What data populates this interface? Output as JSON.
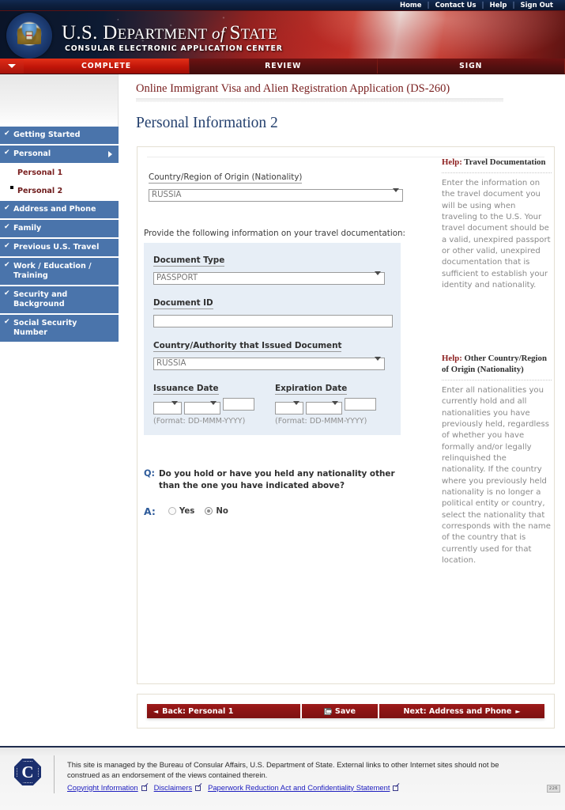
{
  "utility": {
    "links": [
      "Home",
      "Contact Us",
      "Help",
      "Sign Out"
    ],
    "separator": "|"
  },
  "banner": {
    "title_us": "U.S. D",
    "title_epartment": "EPARTMENT",
    "title_of": " of ",
    "title_s": "S",
    "title_tate": "TATE",
    "subtitle": "CONSULAR ELECTRONIC APPLICATION CENTER",
    "seal_name": "us-department-of-state-seal"
  },
  "steps": [
    {
      "label": "COMPLETE",
      "active": true
    },
    {
      "label": "REVIEW",
      "active": false
    },
    {
      "label": "SIGN",
      "active": false
    }
  ],
  "sidebar": {
    "items": [
      {
        "label": "Getting Started",
        "type": "section",
        "check": "✔",
        "expandable": false
      },
      {
        "label": "Personal",
        "type": "section",
        "check": "✔",
        "expandable": true
      },
      {
        "label": "Personal 1",
        "type": "sub",
        "current": false
      },
      {
        "label": "Personal 2",
        "type": "sub",
        "current": true
      },
      {
        "label": "Address and Phone",
        "type": "section",
        "check": "✔",
        "expandable": false
      },
      {
        "label": "Family",
        "type": "section",
        "check": "✔",
        "expandable": false
      },
      {
        "label": "Previous U.S. Travel",
        "type": "section",
        "check": "✔",
        "expandable": false
      },
      {
        "label": "Work / Education / Training",
        "type": "section",
        "check": "✔",
        "expandable": false
      },
      {
        "label": "Security and Background",
        "type": "section",
        "check": "✔",
        "expandable": false
      },
      {
        "label": "Social Security Number",
        "type": "section",
        "check": "✔",
        "expandable": false
      }
    ]
  },
  "main": {
    "form_title": "Online Immigrant Visa and Alien Registration Application (DS-260)",
    "page_heading": "Personal Information 2",
    "nationality": {
      "label": "Country/Region of Origin (Nationality)",
      "value": "RUSSIA"
    },
    "travel_doc": {
      "intro": "Provide the following information on your travel documentation:",
      "doc_type_label": "Document Type",
      "doc_type_value": "PASSPORT",
      "doc_id_label": "Document ID",
      "doc_id_value": "",
      "issuer_label": "Country/Authority that Issued Document",
      "issuer_value": "RUSSIA",
      "issuance_label": "Issuance Date",
      "issuance_day": "",
      "issuance_month": "",
      "issuance_year": "",
      "issuance_format": "(Format: DD-MMM-YYYY)",
      "expiration_label": "Expiration Date",
      "expiration_day": "",
      "expiration_month": "",
      "expiration_year": "",
      "expiration_format": "(Format: DD-MMM-YYYY)"
    },
    "question": {
      "q_marker": "Q:",
      "q_text": "Do you hold or have you held any nationality other than the one you have indicated above?",
      "a_marker": "A:",
      "option_yes": "Yes",
      "option_no": "No",
      "selected": "No"
    }
  },
  "help": {
    "block1": {
      "head_word": "Help:",
      "head_rest": " Travel Documentation",
      "body": "Enter the information on the travel document you will be using when traveling to the U.S. Your travel document should be a valid, unexpired passport or other valid, unexpired documentation that is sufficient to establish your identity and nationality."
    },
    "block2": {
      "head_word": "Help:",
      "head_rest": " Other Country/Region of Origin (Nationality)",
      "body": "Enter all nationalities you currently hold and all nationalities you have previously held, regardless of whether you have formally and/or legally relinquished the nationality. If the country where you previously held nationality is no longer a political entity or country, select the nationality that corresponds with the name of the country that is currently used for that location."
    }
  },
  "buttons": {
    "back": "Back: Personal 1",
    "back_arrow": "◄",
    "save": "Save",
    "next": "Next: Address and Phone",
    "next_arrow": "►"
  },
  "footer": {
    "seal_letter": "C",
    "text": "This site is managed by the Bureau of Consular Affairs, U.S. Department of State. External links to other Internet sites should not be construed as an endorsement of the views contained therein.",
    "links": [
      "Copyright Information",
      "Disclaimers",
      "Paperwork Reduction Act and Confidentiality Statement"
    ],
    "badge": "226"
  },
  "colors": {
    "nav_blue": "#4a74ab",
    "heading_blue": "#24406e",
    "title_red": "#7a2020",
    "button_red": "#8b1414",
    "active_tab_red": "#c11509",
    "help_panel_blue": "#e7eef6",
    "link_blue": "#2020c0"
  }
}
